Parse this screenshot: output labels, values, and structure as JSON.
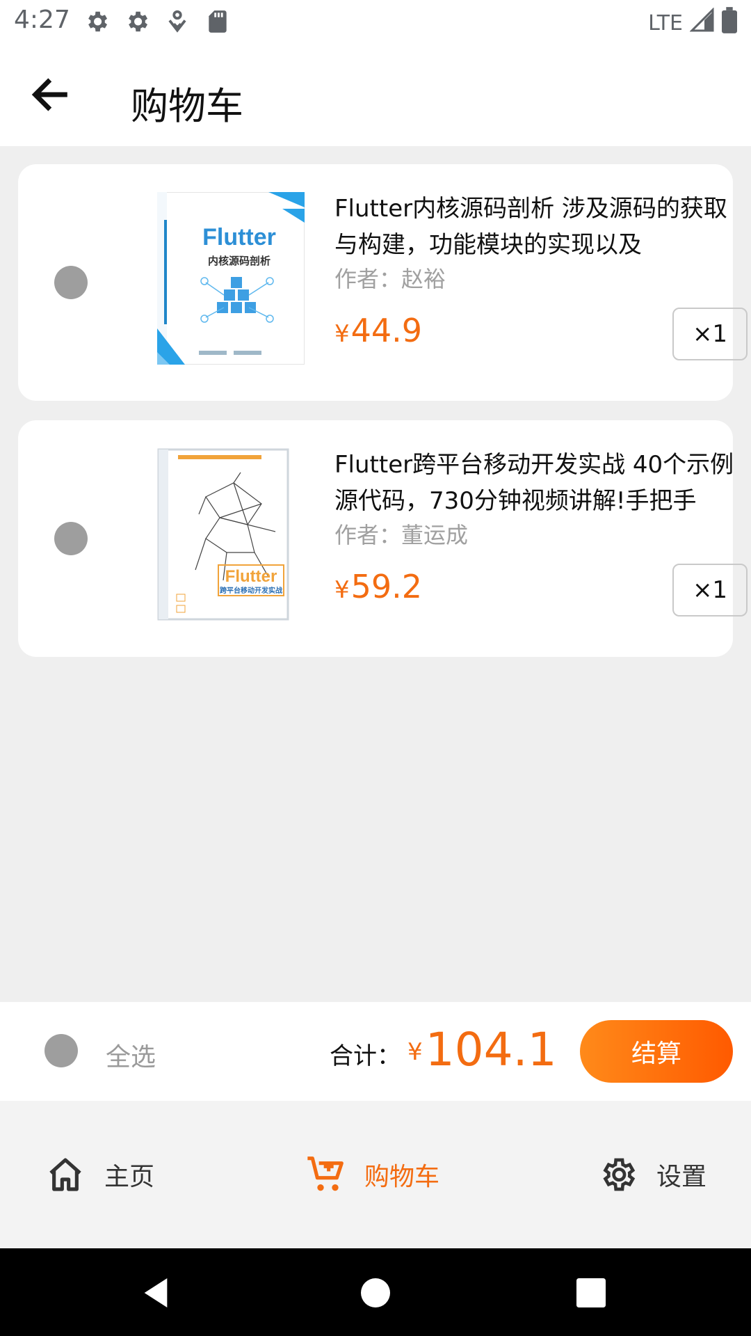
{
  "status_bar": {
    "time": "4:27",
    "network": "LTE"
  },
  "app_bar": {
    "title": "购物车"
  },
  "cart_items": [
    {
      "title": "Flutter内核源码剖析 涉及源码的获取与构建，功能模块的实现以及",
      "author": "作者：赵裕",
      "price_symbol": "¥",
      "price": "44.9",
      "quantity": "×1",
      "cover_title": "Flutter",
      "cover_subtitle": "内核源码剖析"
    },
    {
      "title": "Flutter跨平台移动开发实战 40个示例源代码，730分钟视频讲解!手把手",
      "author": "作者：董运成",
      "price_symbol": "¥",
      "price": "59.2",
      "quantity": "×1",
      "cover_title": "Flutter",
      "cover_subtitle": "跨平台移动开发实战"
    }
  ],
  "checkout": {
    "select_all_label": "全选",
    "total_label": "合计：",
    "total_symbol": "¥",
    "total_amount": "104.1",
    "checkout_label": "结算"
  },
  "bottom_nav": {
    "items": [
      {
        "label": "主页",
        "icon": "home-icon"
      },
      {
        "label": "购物车",
        "icon": "cart-icon",
        "active": true
      },
      {
        "label": "设置",
        "icon": "gear-icon"
      }
    ]
  },
  "colors": {
    "accent": "#f36c11",
    "radio": "#9e9e9e"
  }
}
